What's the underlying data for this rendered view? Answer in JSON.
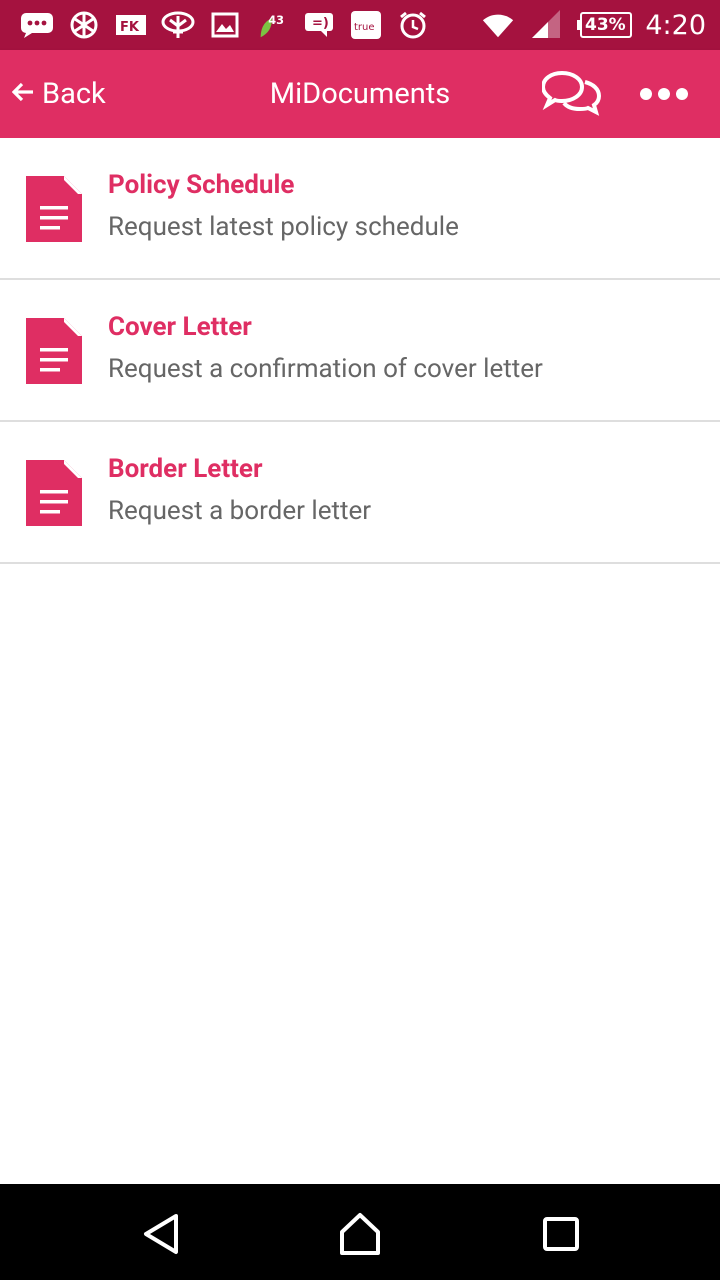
{
  "status_bar": {
    "notification_badge": "43",
    "true_badge": "true",
    "battery": "43%",
    "time": "4:20",
    "icons": [
      "messages-icon",
      "globe-icon",
      "fk-app-icon",
      "tree-bank-icon",
      "gallery-icon",
      "leaf-icon",
      "chat-bubble-icon",
      "true-app-icon",
      "alarm-icon",
      "wifi-icon",
      "cell-signal-icon",
      "battery-icon"
    ]
  },
  "app_bar": {
    "back_label": "Back",
    "title": "MiDocuments",
    "chat_icon": "chat-bubbles-icon",
    "more_icon": "more-dots-icon"
  },
  "documents": [
    {
      "title": "Policy Schedule",
      "description": "Request latest policy schedule",
      "icon": "document-icon"
    },
    {
      "title": "Cover Letter",
      "description": "Request a confirmation of cover letter",
      "icon": "document-icon"
    },
    {
      "title": "Border Letter",
      "description": "Request a border letter",
      "icon": "document-icon"
    }
  ],
  "nav_bar": {
    "back": "back-triangle-icon",
    "home": "home-icon",
    "recents": "recents-square-icon"
  },
  "colors": {
    "status_bar": "#a5123f",
    "app_bar": "#df2e63",
    "accent": "#df2e63",
    "description_text": "#666666",
    "divider": "#dedede",
    "nav_bar": "#000000"
  }
}
